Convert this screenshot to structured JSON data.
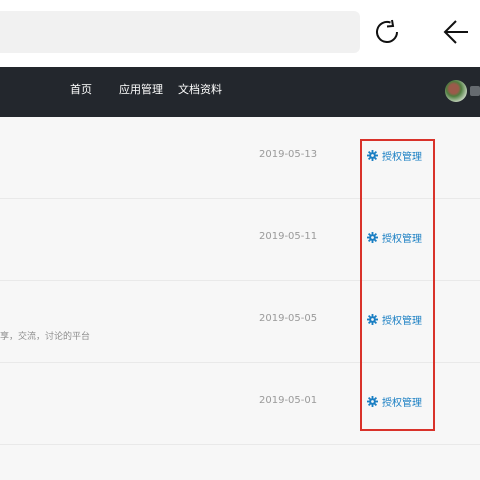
{
  "browser": {
    "url_value": "",
    "reload_icon": "reload-icon",
    "back_icon": "arrow-left-icon"
  },
  "nav": {
    "items": [
      {
        "label": "首页"
      },
      {
        "label": "应用管理"
      },
      {
        "label": "文档资料"
      }
    ],
    "avatar_icon": "user-avatar"
  },
  "rows": [
    {
      "description": "",
      "date": "2019-05-13",
      "action_label": "授权管理",
      "action_icon": "gear-icon"
    },
    {
      "description": "",
      "date": "2019-05-11",
      "action_label": "授权管理",
      "action_icon": "gear-icon"
    },
    {
      "description": "享，交流，讨论的平台",
      "date": "2019-05-05",
      "action_label": "授权管理",
      "action_icon": "gear-icon"
    },
    {
      "description": "",
      "date": "2019-05-01",
      "action_label": "授权管理",
      "action_icon": "gear-icon"
    }
  ],
  "colors": {
    "navbar_bg": "#23272d",
    "action_link": "#1a7fc3",
    "highlight_border": "#d9322a",
    "date_text": "#9a9a9a"
  }
}
